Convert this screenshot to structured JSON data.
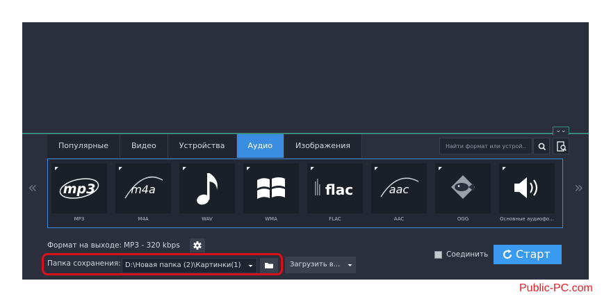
{
  "tabs": [
    {
      "label": "Популярные"
    },
    {
      "label": "Видео"
    },
    {
      "label": "Устройства"
    },
    {
      "label": "Аудио",
      "active": true
    },
    {
      "label": "Изображения"
    }
  ],
  "search": {
    "placeholder": "Найти формат или устрой..."
  },
  "navigation": {
    "prev_arrow": "«",
    "next_arrow": "»"
  },
  "formats": [
    {
      "label": "MP3",
      "icon_text": "mp3",
      "icon": "mp3-logo-icon"
    },
    {
      "label": "M4A",
      "icon_text": "m4a",
      "icon": "m4a-logo-icon"
    },
    {
      "label": "WAV",
      "icon": "music-note-icon"
    },
    {
      "label": "WMA",
      "icon": "windows-logo-icon"
    },
    {
      "label": "FLAC",
      "icon_text": "flac",
      "icon": "flac-logo-icon"
    },
    {
      "label": "AAC",
      "icon_text": "aac",
      "icon": "aac-logo-icon"
    },
    {
      "label": "OGG",
      "icon": "ogg-fish-icon"
    },
    {
      "label": "Основные аудиофо...",
      "icon": "speaker-icon"
    }
  ],
  "output": {
    "label": "Формат на выходе:",
    "value": "MP3 - 320 kbps"
  },
  "save": {
    "label": "Папка сохранения:",
    "path": "D:\\Новая папка (2)\\Картинки(1)"
  },
  "upload": {
    "label": "Загрузить в..."
  },
  "merge": {
    "label": "Соединить",
    "checked": false
  },
  "start": {
    "label": "Старт"
  },
  "watermark": "Public-PC.com",
  "colors": {
    "background": "#2b2f3b",
    "accent": "#3a8de0",
    "start_button": "#3a9af0",
    "highlight": "#d9101a",
    "divider": "#3c8a7e"
  }
}
